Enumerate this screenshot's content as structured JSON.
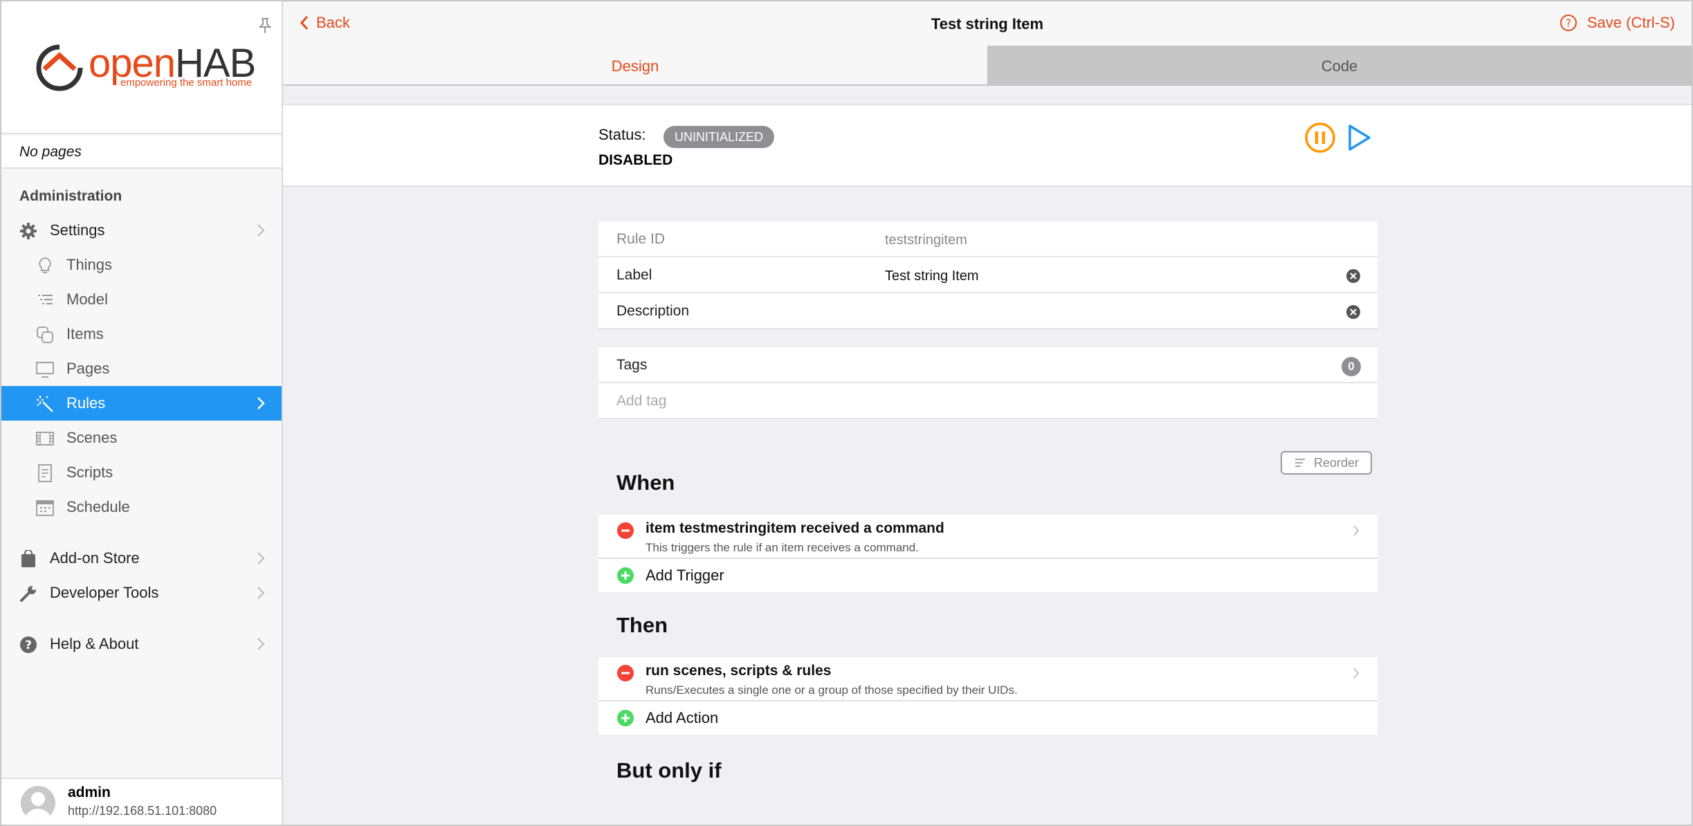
{
  "sidebar": {
    "brand": {
      "part1": "open",
      "part2": "HAB",
      "tagline": "empowering the smart home"
    },
    "no_pages": "No pages",
    "admin_title": "Administration",
    "items": [
      {
        "label": "Settings",
        "icon": "gear-icon"
      },
      {
        "label": "Things",
        "icon": "lightbulb-icon"
      },
      {
        "label": "Model",
        "icon": "list-icon"
      },
      {
        "label": "Items",
        "icon": "square-stack-icon"
      },
      {
        "label": "Pages",
        "icon": "monitor-icon"
      },
      {
        "label": "Rules",
        "icon": "magic-wand-icon",
        "active": true
      },
      {
        "label": "Scenes",
        "icon": "film-icon"
      },
      {
        "label": "Scripts",
        "icon": "document-icon"
      },
      {
        "label": "Schedule",
        "icon": "calendar-icon"
      },
      {
        "label": "Add-on Store",
        "icon": "bag-icon"
      },
      {
        "label": "Developer Tools",
        "icon": "wrench-icon"
      },
      {
        "label": "Help & About",
        "icon": "question-icon"
      }
    ],
    "user": {
      "name": "admin",
      "host": "http://192.168.51.101:8080"
    }
  },
  "topbar": {
    "back_label": "Back",
    "title": "Test string Item",
    "save_label": "Save (Ctrl-S)"
  },
  "tabs": {
    "design": "Design",
    "code": "Code"
  },
  "status": {
    "label": "Status:",
    "badge": "UNINITIALIZED",
    "detail": "DISABLED"
  },
  "rule": {
    "rule_id_label": "Rule ID",
    "rule_id_value": "teststringitem",
    "label_label": "Label",
    "label_value": "Test string Item",
    "description_label": "Description",
    "description_value": ""
  },
  "tags": {
    "label": "Tags",
    "count": "0",
    "placeholder": "Add tag"
  },
  "reorder_label": "Reorder",
  "when": {
    "title": "When",
    "trigger_title": "item testmestringitem received a command",
    "trigger_desc": "This triggers the rule if an item receives a command.",
    "add_label": "Add Trigger"
  },
  "then": {
    "title": "Then",
    "action_title": "run scenes, scripts & rules",
    "action_desc": "Runs/Executes a single one or a group of those specified by their UIDs.",
    "add_label": "Add Action"
  },
  "but_only_if": {
    "title": "But only if"
  },
  "colors": {
    "accent": "#e64a19",
    "active": "#2196f3",
    "remove": "#f44336",
    "add": "#4cd964",
    "pause": "#ff9800"
  }
}
